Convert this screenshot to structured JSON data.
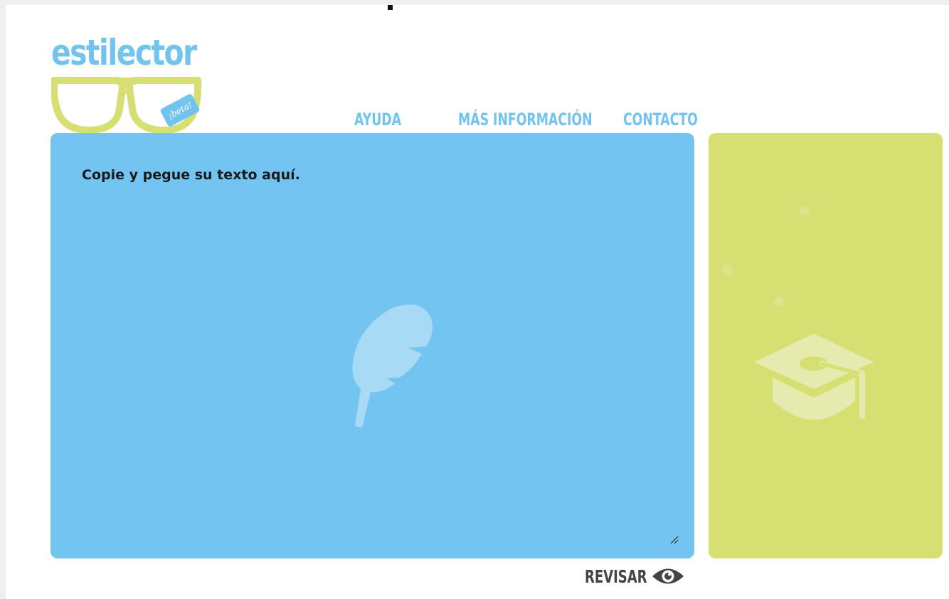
{
  "app": {
    "logo_text": "estilector",
    "beta_badge": "¡beta!",
    "logo_mark": "yl"
  },
  "nav": {
    "items": [
      {
        "label": "AYUDA"
      },
      {
        "label": "MÁS INFORMACIÓN"
      },
      {
        "label": "CONTACTO"
      }
    ]
  },
  "editor": {
    "placeholder": "Copie y pegue su texto aquí.",
    "value": "",
    "background_icon": "feather-icon",
    "color": "#73c4f0"
  },
  "side_panel": {
    "background_icon": "graduation-cap-icon",
    "color": "#d5df72"
  },
  "actions": {
    "review_label": "REVISAR",
    "review_icon": "eye-icon"
  }
}
